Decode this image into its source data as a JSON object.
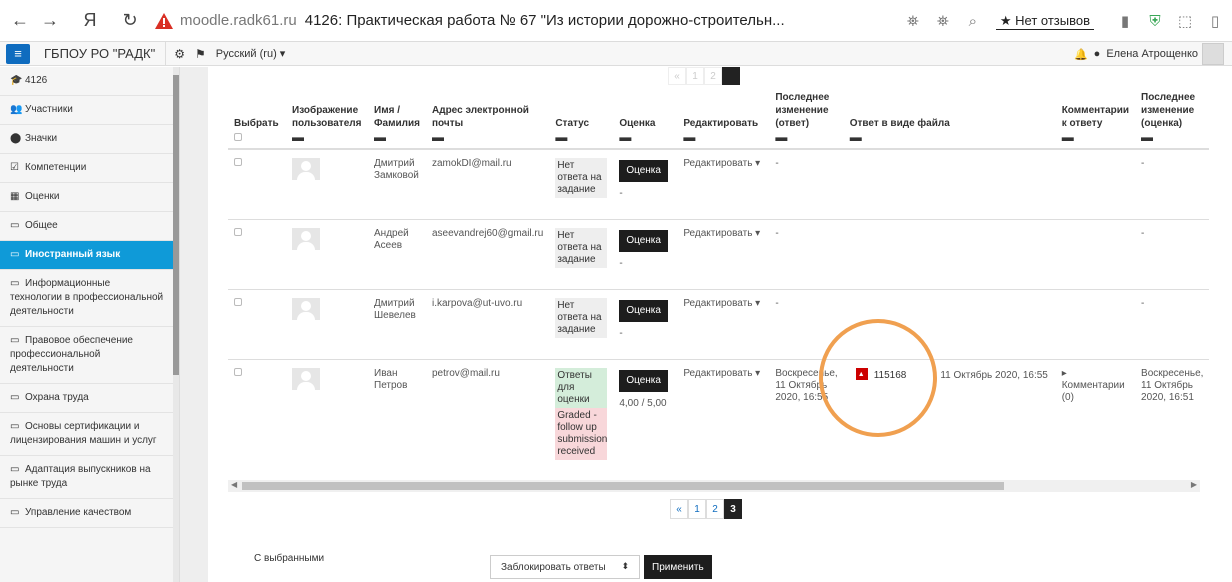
{
  "browser": {
    "back_icon": "←",
    "forward_icon": "→",
    "yandex_icon": "Я",
    "reload_icon": "↻",
    "domain": "moodle.radk61.ru",
    "page_title": "4126: Практическая работа № 67 \"Из истории дорожно-строительн...",
    "no_reviews": "★ Нет отзывов"
  },
  "header": {
    "menu_icon": "≡",
    "site_name": "ГБПОУ РО \"РАДК\"",
    "language": "Русский (ru) ▾",
    "user_name": "Елена Атрощенко"
  },
  "sidebar": {
    "items": [
      {
        "icon": "🎓",
        "label": "4126"
      },
      {
        "icon": "👥",
        "label": "Участники"
      },
      {
        "icon": "⬤",
        "label": "Значки"
      },
      {
        "icon": "☑",
        "label": "Компетенции"
      },
      {
        "icon": "▦",
        "label": "Оценки"
      },
      {
        "icon": "▭",
        "label": "Общее"
      },
      {
        "icon": "▭",
        "label": "Иностранный язык",
        "active": true
      },
      {
        "icon": "▭",
        "label": "Информационные технологии в профессиональной деятельности"
      },
      {
        "icon": "▭",
        "label": "Правовое обеспечение профессиональной деятельности"
      },
      {
        "icon": "▭",
        "label": "Охрана труда"
      },
      {
        "icon": "▭",
        "label": "Основы сертификации и лицензирования машин и услуг"
      },
      {
        "icon": "▭",
        "label": "Адаптация выпускников на рынке труда"
      },
      {
        "icon": "▭",
        "label": "Управление качеством"
      }
    ]
  },
  "table": {
    "headers": {
      "select": "Выбрать",
      "picture": "Изображение пользователя",
      "name": "Имя / Фамилия",
      "email": "Адрес электронной почты",
      "status": "Статус",
      "grade": "Оценка",
      "edit": "Редактировать",
      "last_modified": "Последнее изменение (ответ)",
      "file": "Ответ в виде файла",
      "comments": "Комментарии к ответу",
      "last_modified_grade": "Последнее изменение (оценка)"
    },
    "rows": [
      {
        "name": "Дмитрий Замковой",
        "email": "zamokDI@mail.ru",
        "status": "Нет ответа на задание",
        "grade_btn": "Оценка",
        "grade_val": "-",
        "edit": "Редактировать ▾",
        "last_modified": "-",
        "file": "",
        "file_date": "",
        "comments": "",
        "grade_modified": "-"
      },
      {
        "name": "Андрей Асеев",
        "email": "aseevandrej60@gmail.ru",
        "status": "Нет ответа на задание",
        "grade_btn": "Оценка",
        "grade_val": "-",
        "edit": "Редактировать ▾",
        "last_modified": "-",
        "file": "",
        "file_date": "",
        "comments": "",
        "grade_modified": "-"
      },
      {
        "name": "Дмитрий Шевелев",
        "email": "i.karpova@ut-uvo.ru",
        "status": "Нет ответа на задание",
        "grade_btn": "Оценка",
        "grade_val": "-",
        "edit": "Редактировать ▾",
        "last_modified": "-",
        "file": "",
        "file_date": "",
        "comments": "",
        "grade_modified": "-"
      },
      {
        "name": "Иван Петров",
        "email": "petrov@mail.ru",
        "status": "Ответы для оценки",
        "status2": "Graded - follow up submission received",
        "grade_btn": "Оценка",
        "grade_val": "4,00 / 5,00",
        "edit": "Редактировать ▾",
        "last_modified": "Воскресенье, 11 Октябрь 2020, 16:55",
        "file": "115168",
        "file_date": "11 Октябрь 2020, 16:55",
        "comments": "▸ Комментарии (0)",
        "grade_modified": "Воскресенье, 11 Октябрь 2020, 16:51"
      }
    ]
  },
  "pager": {
    "pages": [
      "«",
      "1",
      "2",
      "3"
    ],
    "current": "3"
  },
  "footer": {
    "with_selected": "С выбранными",
    "select_value": "Заблокировать ответы",
    "apply": "Применить"
  }
}
